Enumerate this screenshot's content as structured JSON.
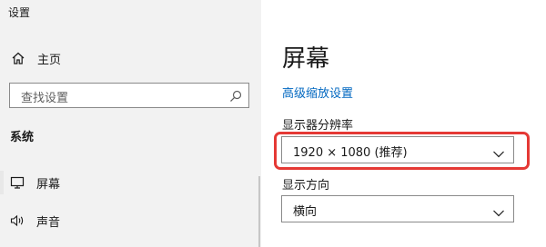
{
  "window": {
    "title": "设置"
  },
  "sidebar": {
    "home_label": "主页",
    "search_placeholder": "查找设置",
    "section_heading": "系统",
    "items": [
      {
        "label": "屏幕",
        "icon": "monitor-icon",
        "selected": true
      },
      {
        "label": "声音",
        "icon": "speaker-icon",
        "selected": false
      }
    ]
  },
  "main": {
    "title": "屏幕",
    "advanced_link": "高级缩放设置",
    "resolution": {
      "label": "显示器分辨率",
      "value": "1920 × 1080 (推荐)"
    },
    "orientation": {
      "label": "显示方向",
      "value": "横向"
    }
  },
  "colors": {
    "accent": "#0067c0",
    "highlight": "#e53935",
    "sidebar_bg": "#f2f2f2"
  }
}
